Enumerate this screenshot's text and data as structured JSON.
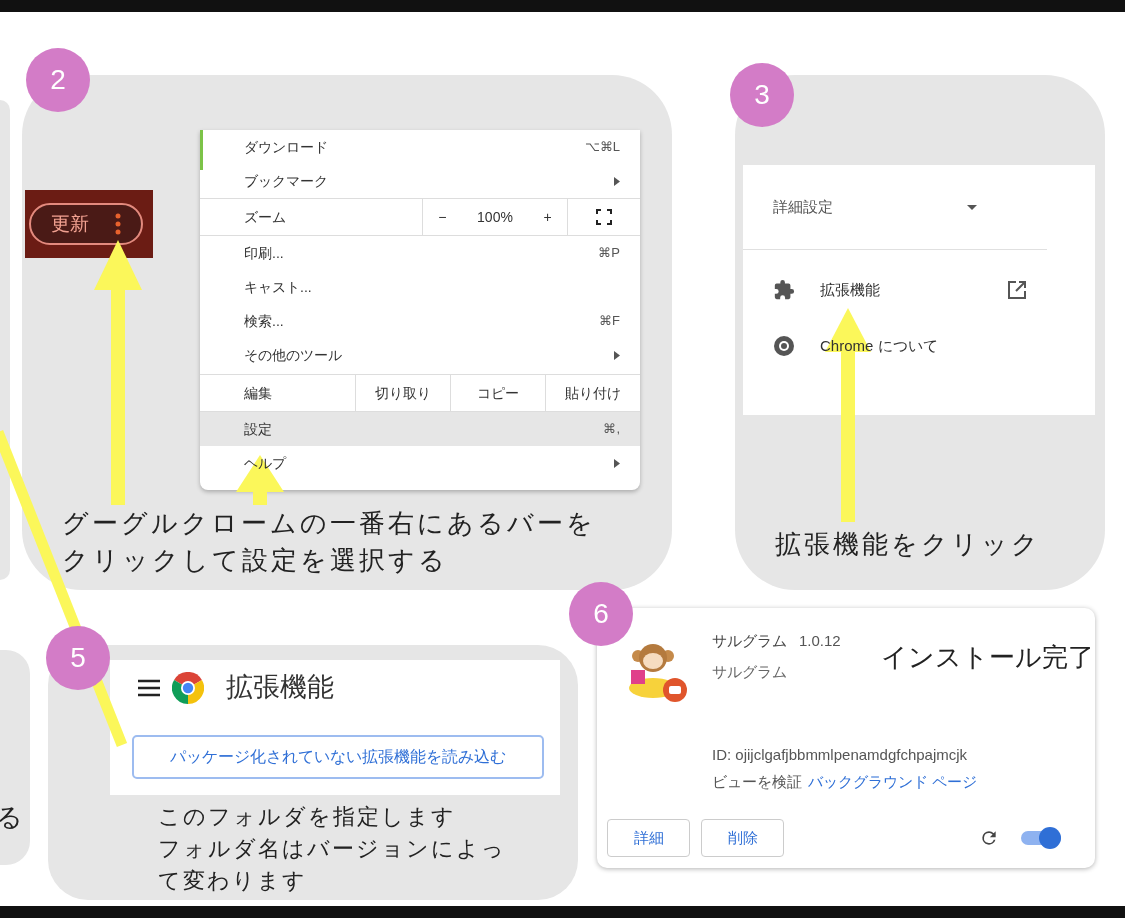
{
  "left_fragment": {
    "text": "る"
  },
  "step2": {
    "badge": "2",
    "photo_button": {
      "label": "更新"
    },
    "menu": {
      "items": [
        {
          "kind": "item",
          "label": "ダウンロード",
          "shortcut": "⌥⌘L",
          "selected": false
        },
        {
          "kind": "submenu",
          "label": "ブックマーク",
          "selected": false
        },
        {
          "kind": "zoom",
          "label": "ズーム",
          "minus": "−",
          "value": "100%",
          "plus": "+",
          "selected": false
        },
        {
          "kind": "item",
          "label": "印刷...",
          "shortcut": "⌘P",
          "selected": false
        },
        {
          "kind": "item",
          "label": "キャスト...",
          "selected": false
        },
        {
          "kind": "item",
          "label": "検索...",
          "shortcut": "⌘F",
          "selected": false
        },
        {
          "kind": "submenu",
          "label": "その他のツール",
          "selected": false
        },
        {
          "kind": "edit",
          "label": "編集",
          "actions": [
            "切り取り",
            "コピー",
            "貼り付け"
          ],
          "selected": false
        },
        {
          "kind": "item",
          "label": "設定",
          "shortcut": "⌘,",
          "selected": true
        },
        {
          "kind": "submenu",
          "label": "ヘルプ",
          "selected": false
        }
      ]
    },
    "caption": [
      "グーグルクロームの一番右にあるバーを",
      "クリックして設定を選択する"
    ]
  },
  "step3": {
    "badge": "3",
    "settings": {
      "items": [
        {
          "kind": "dropdown",
          "label": "詳細設定"
        },
        {
          "kind": "external",
          "label": "拡張機能"
        },
        {
          "kind": "about",
          "label": "Chrome について"
        }
      ]
    },
    "caption": "拡張機能をクリック"
  },
  "step5": {
    "badge": "5",
    "header": {
      "title": "拡張機能"
    },
    "load_button": "パッケージ化されていない拡張機能を読み込む",
    "caption": [
      "このフォルダを指定します",
      "フォルダ名はバージョンによっ",
      "て変わります"
    ]
  },
  "step6": {
    "badge": "6",
    "note": "インストール完了",
    "extension": {
      "name": "サルグラム",
      "version": "1.0.12",
      "description": "サルグラム",
      "id": "ID: ojijclgafjbbmmlpenamdgfchpajmcjk",
      "inspect_label": "ビューを検証",
      "inspect_link": "バックグラウンド ページ",
      "buttons": [
        "詳細",
        "削除"
      ],
      "enabled": true
    }
  }
}
